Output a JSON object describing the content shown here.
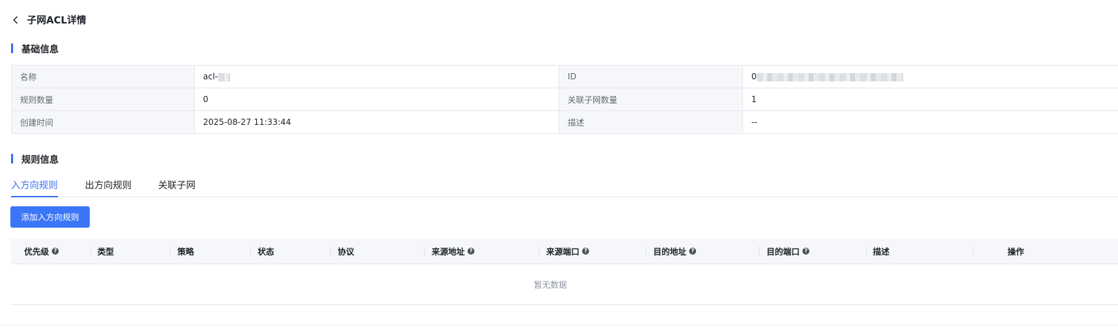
{
  "header": {
    "title": "子网ACL详情"
  },
  "basic_section": {
    "title": "基础信息"
  },
  "info": {
    "name_label": "名称",
    "name_value": "acl-",
    "id_label": "ID",
    "id_value": "0",
    "rule_count_label": "规则数量",
    "rule_count_value": "0",
    "subnet_count_label": "关联子网数量",
    "subnet_count_value": "1",
    "created_label": "创建时间",
    "created_value": "2025-08-27 11:33:44",
    "desc_label": "描述",
    "desc_value": "--"
  },
  "rules_section": {
    "title": "规则信息"
  },
  "tabs": [
    {
      "label": "入方向规则",
      "active": true
    },
    {
      "label": "出方向规则",
      "active": false
    },
    {
      "label": "关联子网",
      "active": false
    }
  ],
  "add_button_label": "添加入方向规则",
  "table": {
    "columns": [
      {
        "label": "优先级",
        "help": true
      },
      {
        "label": "类型",
        "help": false
      },
      {
        "label": "策略",
        "help": false
      },
      {
        "label": "状态",
        "help": false
      },
      {
        "label": "协议",
        "help": false
      },
      {
        "label": "来源地址",
        "help": true
      },
      {
        "label": "来源端口",
        "help": true
      },
      {
        "label": "目的地址",
        "help": true
      },
      {
        "label": "目的端口",
        "help": true
      },
      {
        "label": "描述",
        "help": false
      },
      {
        "label": "操作",
        "help": false
      }
    ],
    "empty_text": "暂无数据"
  },
  "icons": {
    "back": "chevron-left-icon",
    "help": "question-circle-icon"
  },
  "colors": {
    "accent": "#3b6ef5",
    "button": "#3b76f7",
    "header_bg": "#f5f7fa",
    "border": "#e5e7eb"
  }
}
